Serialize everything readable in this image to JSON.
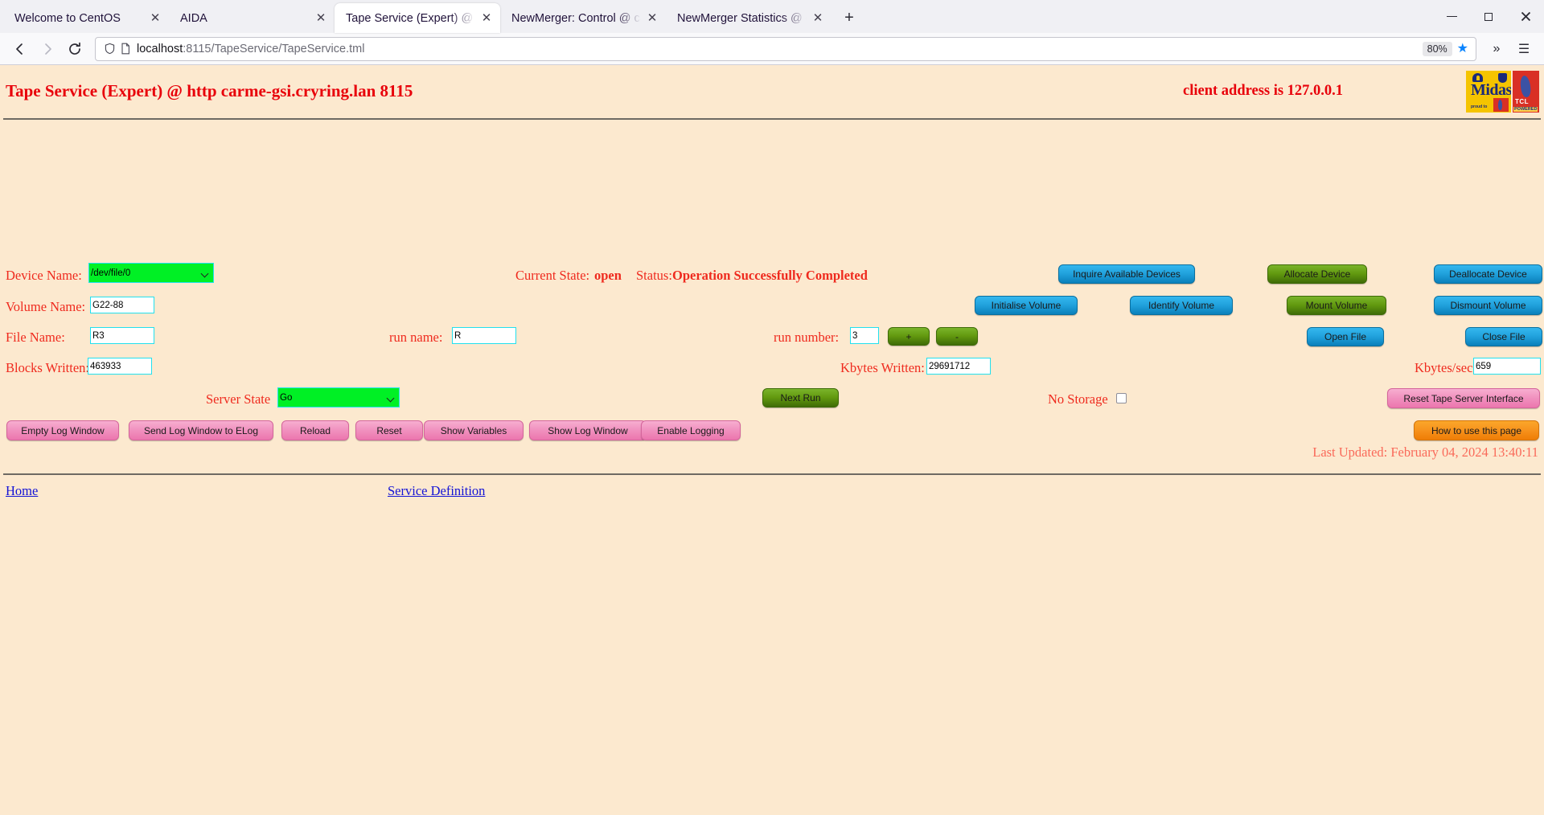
{
  "browser": {
    "tabs": [
      {
        "title": "Welcome to CentOS",
        "active": false
      },
      {
        "title": "AIDA",
        "active": false
      },
      {
        "title": "Tape Service (Expert) @ carme",
        "active": true
      },
      {
        "title": "NewMerger: Control @ carme",
        "active": false
      },
      {
        "title": "NewMerger Statistics @ carm",
        "active": false
      }
    ],
    "new_tab_label": "+",
    "close_glyph": "✕",
    "url": "localhost:8115/TapeService/TapeService.tml",
    "url_host": "localhost",
    "url_rest": ":8115/TapeService/TapeService.tml",
    "zoom_level": "80%",
    "bookmark_star": "★",
    "overflow_glyph": "»",
    "menu_glyph": "☰"
  },
  "page": {
    "title": "Tape Service (Expert) @ http carme-gsi.cryring.lan 8115",
    "client_address": "client address is 127.0.0.1",
    "logo_midas": "Midas",
    "logo_midas_sub": "proud to",
    "logo_tcl": "TCL",
    "logo_tcl_sub": "POWERED",
    "device_name_label": "Device Name:",
    "device_name_value": "/dev/file/0",
    "device_name_options": [
      "/dev/file/0"
    ],
    "volume_name_label": "Volume Name:",
    "volume_name_value": "G22-88",
    "file_name_label": "File Name:",
    "file_name_value": "R3",
    "run_name_label": "run name:",
    "run_name_value": "R",
    "run_number_label": "run number:",
    "run_number_value": "3",
    "run_plus_label": "+",
    "run_minus_label": "-",
    "blocks_written_label": "Blocks Written:",
    "blocks_written_value": "463933",
    "kbytes_written_label": "Kbytes Written:",
    "kbytes_written_value": "29691712",
    "kbytes_sec_label": "Kbytes/sec:",
    "kbytes_sec_value": "659",
    "current_state_label": "Current State:",
    "current_state_value": "open",
    "status_label": "Status:",
    "status_value": "Operation Successfully Completed",
    "server_state_label": "Server State",
    "server_state_value": "Go",
    "server_state_options": [
      "Go"
    ],
    "next_run_label": "Next Run",
    "no_storage_label": "No Storage",
    "no_storage_checked": false,
    "btn_inquire": "Inquire Available Devices",
    "btn_allocate": "Allocate Device",
    "btn_deallocate": "Deallocate Device",
    "btn_initialise": "Initialise Volume",
    "btn_identify": "Identify Volume",
    "btn_mount": "Mount Volume",
    "btn_dismount": "Dismount Volume",
    "btn_open_file": "Open File",
    "btn_close_file": "Close File",
    "btn_reset_tape": "Reset Tape Server Interface",
    "btn_how_to": "How to use this page",
    "btn_empty_log": "Empty Log Window",
    "btn_send_log": "Send Log Window to ELog",
    "btn_reload": "Reload",
    "btn_reset": "Reset",
    "btn_show_vars": "Show Variables",
    "btn_show_log": "Show Log Window",
    "btn_enable_logging": "Enable Logging",
    "last_updated": "Last Updated: February 04, 2024 13:40:11",
    "link_home": "Home",
    "link_service_def": "Service Definition"
  },
  "colors": {
    "page_bg": "#fce9cf",
    "label_red": "#ef2a1e",
    "title_red": "#e8000a",
    "input_border": "#22e0ee",
    "select_green": "#00f025",
    "btn_blue": "#22a3de",
    "btn_green": "#62990f",
    "btn_pink": "#f193c0",
    "btn_orange": "#f7941e",
    "link_blue": "#1414d6",
    "updated_red": "#fa6a5a"
  }
}
